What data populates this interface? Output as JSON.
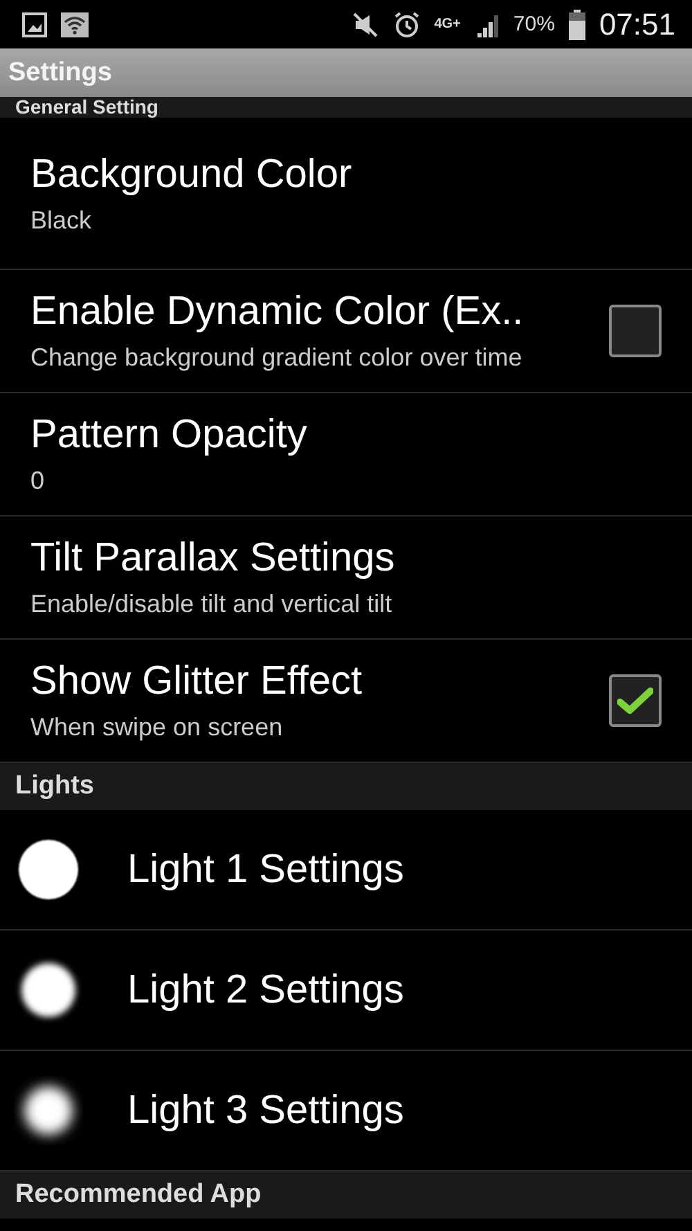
{
  "status_bar": {
    "battery": "70%",
    "time": "07:51",
    "network": "4G+"
  },
  "app_bar": {
    "title": "Settings"
  },
  "sections": [
    {
      "header": "General Setting",
      "items": [
        {
          "kind": "text",
          "title": "Background Color",
          "summary": "Black"
        },
        {
          "kind": "checkbox",
          "title": "Enable Dynamic Color (Ex..",
          "summary": "Change background gradient color over time",
          "checked": false
        },
        {
          "kind": "text",
          "title": "Pattern Opacity",
          "summary": "0"
        },
        {
          "kind": "text",
          "title": "Tilt Parallax Settings",
          "summary": "Enable/disable tilt and vertical tilt"
        },
        {
          "kind": "checkbox",
          "title": "Show Glitter Effect",
          "summary": "When swipe on screen",
          "checked": true
        }
      ]
    },
    {
      "header": "Lights",
      "items": [
        {
          "kind": "light",
          "title": "Light 1 Settings"
        },
        {
          "kind": "light",
          "title": "Light 2 Settings"
        },
        {
          "kind": "light",
          "title": "Light 3 Settings"
        }
      ]
    },
    {
      "header": "Recommended App"
    }
  ]
}
